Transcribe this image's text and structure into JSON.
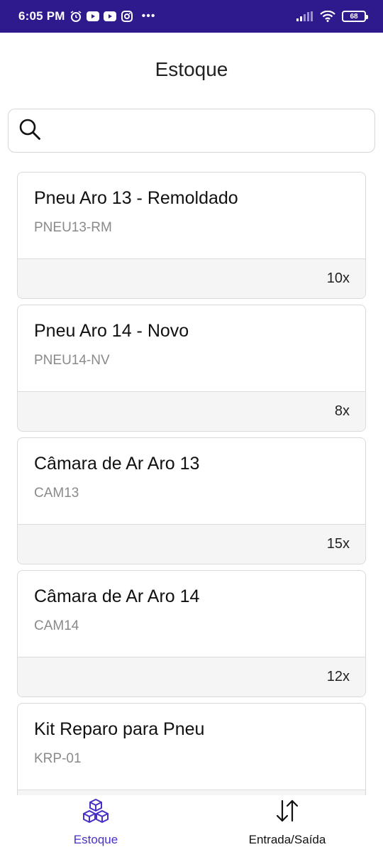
{
  "status_bar": {
    "time": "6:05 PM",
    "battery": "68",
    "icons": [
      "alarm-icon",
      "youtube-icon",
      "youtube-icon",
      "instagram-icon",
      "more-dots-icon",
      "signal-icon",
      "wifi-icon",
      "battery-icon"
    ],
    "bg_color": "#2e1a8c"
  },
  "header": {
    "title": "Estoque"
  },
  "search": {
    "placeholder": "",
    "value": ""
  },
  "products": [
    {
      "name": "Pneu Aro 13 - Remoldado",
      "code": "PNEU13-RM",
      "qty": "10x"
    },
    {
      "name": "Pneu Aro 14 - Novo",
      "code": "PNEU14-NV",
      "qty": "8x"
    },
    {
      "name": "Câmara de Ar Aro 13",
      "code": "CAM13",
      "qty": "15x"
    },
    {
      "name": "Câmara de Ar Aro 14",
      "code": "CAM14",
      "qty": "12x"
    },
    {
      "name": "Kit Reparo para Pneu",
      "code": "KRP-01",
      "qty": ""
    }
  ],
  "bottom_nav": {
    "items": [
      {
        "label": "Estoque",
        "icon": "cubes-icon",
        "active": true
      },
      {
        "label": "Entrada/Saída",
        "icon": "swap-vertical-icon",
        "active": false
      }
    ],
    "accent_color": "#4a2fc7"
  }
}
